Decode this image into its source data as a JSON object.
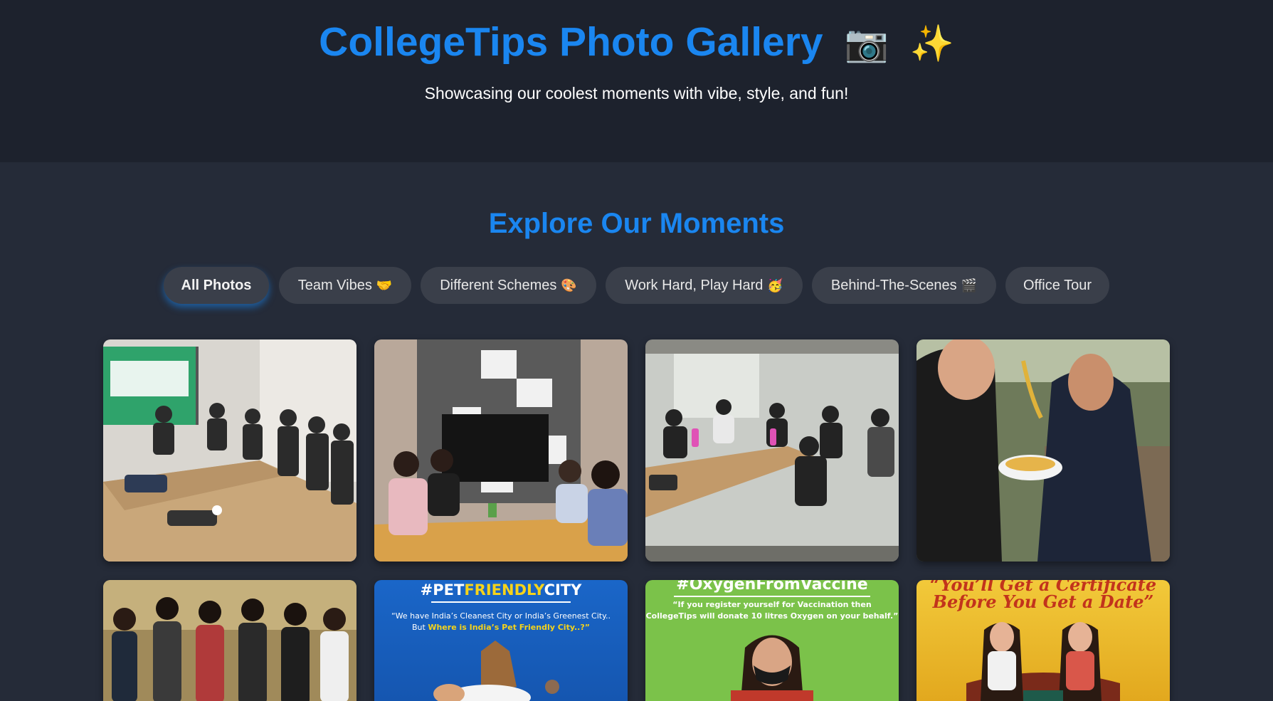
{
  "header": {
    "title": "CollegeTips Photo Gallery",
    "title_emoji_camera": "📷",
    "title_emoji_sparkles": "✨",
    "subtitle": "Showcasing our coolest moments with vibe, style, and fun!"
  },
  "section": {
    "title": "Explore Our Moments"
  },
  "filters": [
    {
      "label": "All Photos",
      "emoji": "",
      "active": true
    },
    {
      "label": "Team Vibes",
      "emoji": "🤝",
      "active": false
    },
    {
      "label": "Different Schemes",
      "emoji": "🎨",
      "active": false
    },
    {
      "label": "Work Hard, Play Hard",
      "emoji": "🥳",
      "active": false
    },
    {
      "label": "Behind-The-Scenes",
      "emoji": "🎬",
      "active": false
    },
    {
      "label": "Office Tour",
      "emoji": "",
      "active": false
    }
  ],
  "posters": {
    "pet": {
      "heading_a": "#PET",
      "heading_b": "FRIENDLY",
      "heading_c": "CITY",
      "quote_line1": "“We have India’s Cleanest City or India’s Greenest City..",
      "quote_line2a": "But ",
      "quote_line2b": "Where is India’s Pet Friendly City..?”"
    },
    "oxygen": {
      "heading": "#OxygenFromVaccine",
      "line1": "“If you register yourself for Vaccination then",
      "line2": "CollegeTips will donate 10 litres Oxygen on your behalf.”"
    },
    "certificate": {
      "line1": "“You’ll Get a Certificate",
      "line2": "Before You Get a Date”"
    }
  },
  "colors": {
    "accent": "#1a86f0",
    "header_bg": "#1d222d",
    "page_bg": "#252b38",
    "pill_bg": "#3a3f4a"
  }
}
